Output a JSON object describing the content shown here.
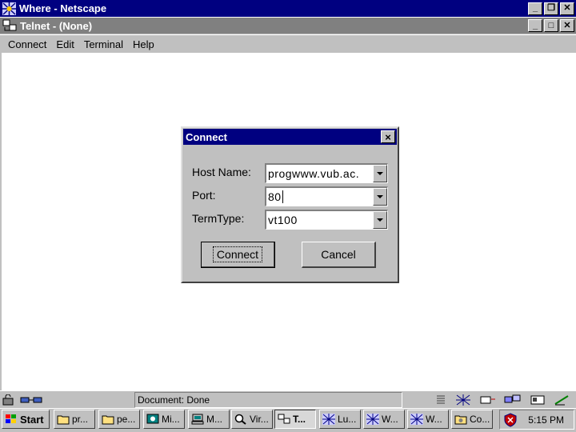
{
  "netscape": {
    "title": "Where - Netscape"
  },
  "telnet": {
    "title": "Telnet - (None)",
    "menu": [
      {
        "label": "Connect"
      },
      {
        "label": "Edit"
      },
      {
        "label": "Terminal"
      },
      {
        "label": "Help"
      }
    ]
  },
  "dialog": {
    "title": "Connect",
    "close": "×",
    "host_label": "Host Name:",
    "host_value": "progwww.vub.ac.",
    "port_label": "Port:",
    "port_value": "80",
    "termtype_label": "TermType:",
    "termtype_value": "vt100",
    "connect_button": "Connect",
    "cancel_button": "Cancel"
  },
  "statusbar": {
    "text": "Document: Done"
  },
  "taskbar": {
    "start": "Start",
    "items": [
      {
        "label": "pr...",
        "icon": "folder-icon"
      },
      {
        "label": "pe...",
        "icon": "folder-icon"
      },
      {
        "label": "Mi...",
        "icon": "presentation-icon"
      },
      {
        "label": "M...",
        "icon": "computer-icon"
      },
      {
        "label": "Vir...",
        "icon": "search-icon"
      },
      {
        "label": "T...",
        "icon": "telnet-icon"
      },
      {
        "label": "Lu...",
        "icon": "netscape-icon"
      },
      {
        "label": "W...",
        "icon": "netscape-icon"
      },
      {
        "label": "W...",
        "icon": "netscape-icon"
      },
      {
        "label": "Co...",
        "icon": "control-panel-icon"
      }
    ],
    "clock": "5:15 PM"
  },
  "colors": {
    "titlebar": "#000080",
    "face": "#c0c0c0",
    "desktop": "#ffffff"
  }
}
